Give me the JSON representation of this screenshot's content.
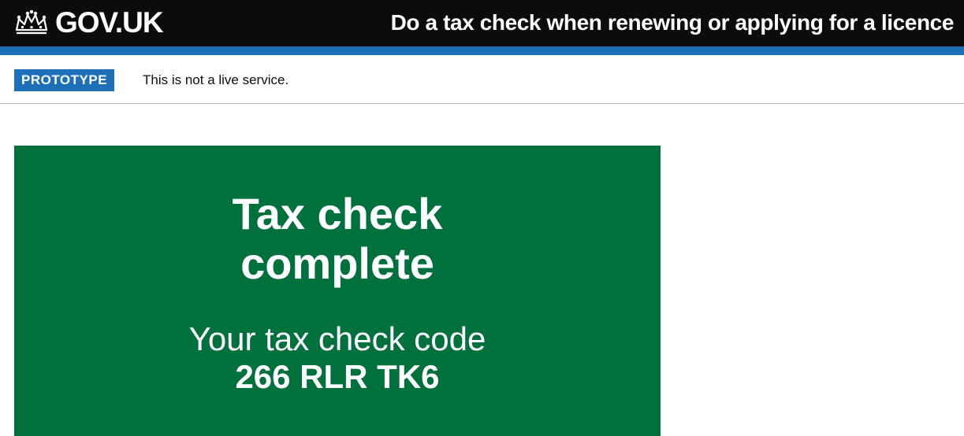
{
  "header": {
    "logo_text": "GOV.UK",
    "service_name": "Do a tax check when renewing or applying for a licence"
  },
  "phase_banner": {
    "tag": "PROTOTYPE",
    "text": "This is not a live service."
  },
  "confirmation_panel": {
    "title_line1": "Tax check",
    "title_line2": "complete",
    "body_label": "Your tax check code",
    "code": "266 RLR TK6"
  },
  "colors": {
    "header_bg": "#0b0c0c",
    "header_bar": "#1d70b8",
    "phase_tag_bg": "#1d70b8",
    "panel_bg": "#00703c",
    "text": "#0b0c0c"
  },
  "icons": {
    "logo": "crown-icon"
  }
}
